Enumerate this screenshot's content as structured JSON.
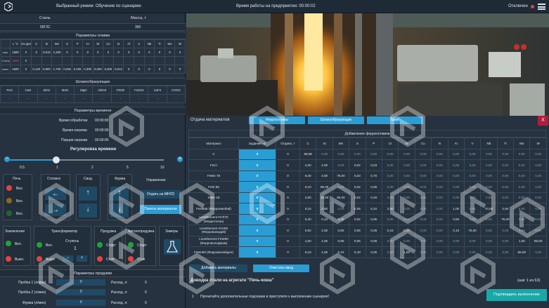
{
  "topbar": {
    "mode": "Выбранный режим: Обучение по сценарию",
    "worktime": "Время работы на предприятии: 00:00:02",
    "status": "Отключен"
  },
  "steel": {
    "col_steel": "Сталь",
    "col_mass": "Масса, т",
    "steel_value": "09Г2С",
    "mass_value": "360"
  },
  "melt": {
    "title": "Параметры плавки",
    "headers": [
      "t, °C",
      "Ox ppm",
      "C",
      "Si",
      "Mn",
      "S",
      "P",
      "Cr",
      "Ni",
      "Cu",
      "N",
      "Al",
      "V",
      "Nb",
      "Ti",
      "Mo",
      "W"
    ],
    "rows": [
      {
        "label": "мин.",
        "values": [
          "1580",
          "0",
          "0",
          "0,510",
          "1,300",
          "0",
          "0",
          "0",
          "0",
          "0",
          "0",
          "0",
          "0",
          "0",
          "0",
          "0",
          "0"
        ]
      },
      {
        "label": "Сталь",
        "values": [
          "1590",
          "0",
          "",
          "",
          "",
          "",
          "",
          "",
          "",
          "",
          "",
          "",
          "",
          "",
          "",
          "",
          ""
        ]
      },
      {
        "label": "макс.",
        "values": [
          "1600",
          "0",
          "0,120",
          "0,800",
          "1,700",
          "0,035",
          "0,035",
          "0,300",
          "0,300",
          "0,300",
          "0,012",
          "0",
          "0",
          "0",
          "0",
          "0",
          "0"
        ]
      }
    ]
  },
  "slag": {
    "title": "Шлакообразующие",
    "headers": [
      "FeO",
      "CaO",
      "SiO2",
      "MnO",
      "MgO",
      "Al2O3",
      "P2O5",
      "Fe2O3",
      "CaF2",
      "Cr2O3"
    ],
    "values": [
      "-",
      "-",
      "-",
      "-",
      "-",
      "-",
      "-",
      "-",
      "-",
      "-"
    ]
  },
  "time": {
    "title": "Параметры времени",
    "rows": [
      {
        "label": "Время обработки",
        "value": "00:00:00"
      },
      {
        "label": "Время нагрева",
        "value": "00:00:00"
      },
      {
        "label": "Порция нагрева",
        "value": "00:00:00"
      }
    ]
  },
  "regulate": {
    "title": "Регулировка времени",
    "marks": [
      "0.5",
      "1",
      "2",
      "5",
      "10"
    ],
    "minus": "−",
    "plus": "+",
    "level": "1"
  },
  "controls": {
    "pech": "Печь",
    "pech_items": [
      "Вкл.",
      "Вкл.",
      "Вкл."
    ],
    "stelvoz": "Стелвоз",
    "svod": "Свод",
    "furma": "Фурма",
    "upr": "Управление",
    "btn_mnlz": "Отдать на МНЛЗ",
    "btn_panel": "Панель материалов",
    "zaz": "Заземление",
    "zaz_on": "Вкл.",
    "zaz_off": "Выкл.",
    "trans": "Трансформатор",
    "stupen": "Ступень",
    "stupen_val": "1",
    "tr_on": "Вкл.",
    "tr_off": "Выкл.",
    "produvka": "Продувка",
    "pr_start": "Старт",
    "pr_stop": "Стоп",
    "argon": "Аргонопродувка",
    "ar_start": "Старт",
    "ar_stop": "Стоп",
    "zamer": "Замеры"
  },
  "purge": {
    "title": "Параметры продувки",
    "rows": [
      {
        "label": "Пробка 1 (л/мин)",
        "value": "0",
        "rate": "Расход, л:",
        "rval": "0"
      },
      {
        "label": "Пробка 2 (л/мин)",
        "value": "0",
        "rate": "Расход, л:",
        "rval": "0"
      },
      {
        "label": "Фурма (л/мин)",
        "value": "0",
        "rate": "Расход, л:",
        "rval": "0"
      }
    ]
  },
  "materials": {
    "title": "Отдача материалов",
    "tabs": [
      "Ферросплавы",
      "Шлакообразующие",
      "Трайб"
    ],
    "close": "X",
    "table_title": "Добавление ферросплавов",
    "headers": [
      "Материал",
      "Задание, кг",
      "Отдано, т",
      "C",
      "Si",
      "Mn",
      "S",
      "P",
      "Cr",
      "Ni",
      "Cu",
      "N",
      "Al",
      "V",
      "Nb",
      "Ti",
      "Mo",
      "W"
    ],
    "rows": [
      {
        "name": "C",
        "input": "0",
        "given": "0",
        "v": [
          "99,95",
          "0,00",
          "0,00",
          "0,00",
          "0,00",
          "0,00",
          "0,00",
          "0,00",
          "0,00",
          "0,00",
          "0,00",
          "0,00",
          "0,00",
          "0,00",
          "0,00"
        ]
      },
      {
        "name": "FeCr",
        "input": "0",
        "given": "0",
        "v": [
          "2,00",
          "2,00",
          "0,00",
          "0,02",
          "0,03",
          "0,00",
          "0,00",
          "0,00",
          "0,00",
          "0,00",
          "0,00",
          "0,00",
          "0,00",
          "0,00",
          "0,00"
        ]
      },
      {
        "name": "FeMn 78",
        "input": "0",
        "given": "0",
        "v": [
          "6,40",
          "4,00",
          "78,00",
          "0,03",
          "0,70",
          "0,00",
          "0,00",
          "0,00",
          "0,00",
          "0,00",
          "0,00",
          "0,00",
          "0,00",
          "0,00",
          "0,00"
        ]
      },
      {
        "name": "FeSi 65",
        "input": "0",
        "given": "0",
        "v": [
          "0,10",
          "65,00",
          "0,00",
          "0,02",
          "0,05",
          "0,00",
          "0,00",
          "0,00",
          "0,00",
          "0,00",
          "0,00",
          "0,00",
          "0,00",
          "0,00",
          "0,00"
        ]
      },
      {
        "name": "SiMn 18",
        "input": "0",
        "given": "0",
        "v": [
          "2,50",
          "18,00",
          "65,00",
          "0,02",
          "0,40",
          "0,00",
          "0,00",
          "0,00",
          "0,00",
          "0,00",
          "0,00",
          "0,00",
          "0,00",
          "0,00",
          "0,00"
        ]
      },
      {
        "name": "FeNb65 (Феррониобий)",
        "input": "0",
        "given": "0",
        "v": [
          "0,15",
          "2,50",
          "0,00",
          "0,05",
          "0,10",
          "2,50",
          "0,00",
          "0,00",
          "0,00",
          "1,00",
          "0,00",
          "70,00",
          "2,50",
          "0,00",
          "0,00"
        ]
      },
      {
        "name": "LineElement FeTi70 (Ферротитан)",
        "input": "0",
        "given": "0",
        "v": [
          "0,20",
          "0,10",
          "0,20",
          "0,02",
          "0,05",
          "0,00",
          "0,00",
          "0,00",
          "0,00",
          "0,50",
          "0,00",
          "0,00",
          "75,00",
          "0,00",
          "0,00"
        ]
      },
      {
        "name": "LineElement FeV80 (Феррованадий)",
        "input": "0",
        "given": "0",
        "v": [
          "0,50",
          "2,00",
          "0,50",
          "0,05",
          "0,06",
          "0,15",
          "0,10",
          "0,00",
          "0,00",
          "0,10",
          "75,00",
          "0,00",
          "0,00",
          "0,00",
          "0,00"
        ]
      },
      {
        "name": "LineElement FeW80 (Ферровольфрам)",
        "input": "0",
        "given": "0",
        "v": [
          "1,00",
          "1,00",
          "0,80",
          "0,05",
          "0,06",
          "0,00",
          "0,00",
          "0,00",
          "0,00",
          "0,00",
          "0,00",
          "0,00",
          "0,00",
          "1,00",
          "85,00"
        ]
      },
      {
        "name": "FeMo60 (Ферромолибден)",
        "input": "0",
        "given": "0",
        "v": [
          "0,10",
          "1,00",
          "0,10",
          "0,10",
          "0,05",
          "0,00",
          "1,00",
          "0,00",
          "0,00",
          "0,00",
          "0,00",
          "0,00",
          "0,00",
          "65,00",
          "0,00"
        ]
      }
    ],
    "btn_add": "Добавить материалы",
    "btn_clear": "Очистить ввод"
  },
  "scenario": {
    "title": "Доводка стали на агрегате \"Печь-ковш\"",
    "step": "(шаг 1 из 63)",
    "num": "1",
    "text": "Прочитайте дополнительные подсказки и приступите к выполнению сценария!",
    "btn": "Подтвердить выполнение"
  },
  "colors": {
    "accent": "#2a9dd4",
    "dark": "#1f4a66",
    "red": "#e2443f",
    "green": "#22a33a",
    "bg": "#253240"
  }
}
